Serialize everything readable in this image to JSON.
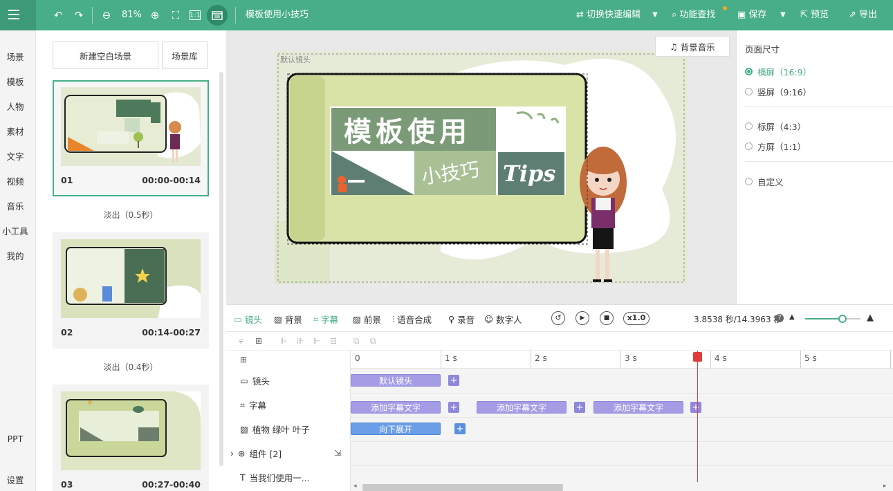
{
  "topbar": {
    "zoom": "81%",
    "doc_title": "模板使用小技巧",
    "switch_edit": "切换快速编辑",
    "feature_search": "功能查找",
    "save": "保存",
    "preview": "预览",
    "export": "导出"
  },
  "leftnav": {
    "items": [
      "场景",
      "模板",
      "人物",
      "素材",
      "文字",
      "视频",
      "音乐",
      "小工具",
      "我的"
    ],
    "ppt": "PPT",
    "settings": "设置"
  },
  "scenes": {
    "new_blank": "新建空白场景",
    "library": "场景库",
    "list": [
      {
        "num": "01",
        "time": "00:00-00:14"
      },
      {
        "num": "02",
        "time": "00:14-00:27"
      },
      {
        "num": "03",
        "time": "00:27-00:40"
      }
    ],
    "transitions": [
      "淡出（0.5秒）",
      "淡出（0.4秒）"
    ]
  },
  "stage": {
    "camera_label": "默认镜头",
    "music_button": "背景音乐",
    "banner_title": "模板使用",
    "banner_sub": "小技巧",
    "banner_tips": "Tips"
  },
  "page_size": {
    "title": "页面尺寸",
    "options": [
      "横屏（16:9）",
      "竖屏（9:16）",
      "标屏（4:3）",
      "方屏（1:1）",
      "自定义"
    ],
    "selected": "横屏（16:9）"
  },
  "timeline": {
    "tools": [
      "镜头",
      "背景",
      "字幕",
      "前景",
      "语音合成",
      "录音",
      "数字人"
    ],
    "speed": "x1.0",
    "time_display": "3.8538 秒/14.3963 秒",
    "playhead_seconds": 3.8538,
    "volume_level": 0.68,
    "ruler": [
      "0",
      "1 s",
      "2 s",
      "3 s",
      "4 s",
      "5 s"
    ],
    "tracks": [
      "镜头",
      "字幕",
      "植物 绿叶 叶子",
      "组件 [2]",
      "当我们使用一..."
    ],
    "camera_clip": "默认镜头",
    "subtitle_clips": [
      "添加字幕文字",
      "添加字幕文字",
      "添加字幕文字"
    ],
    "plant_clip": "向下展开"
  },
  "colors": {
    "accent": "#47ae88",
    "clip_purple": "#a49de6",
    "clip_blue": "#6a9ee6",
    "playhead": "#e23b3b"
  }
}
